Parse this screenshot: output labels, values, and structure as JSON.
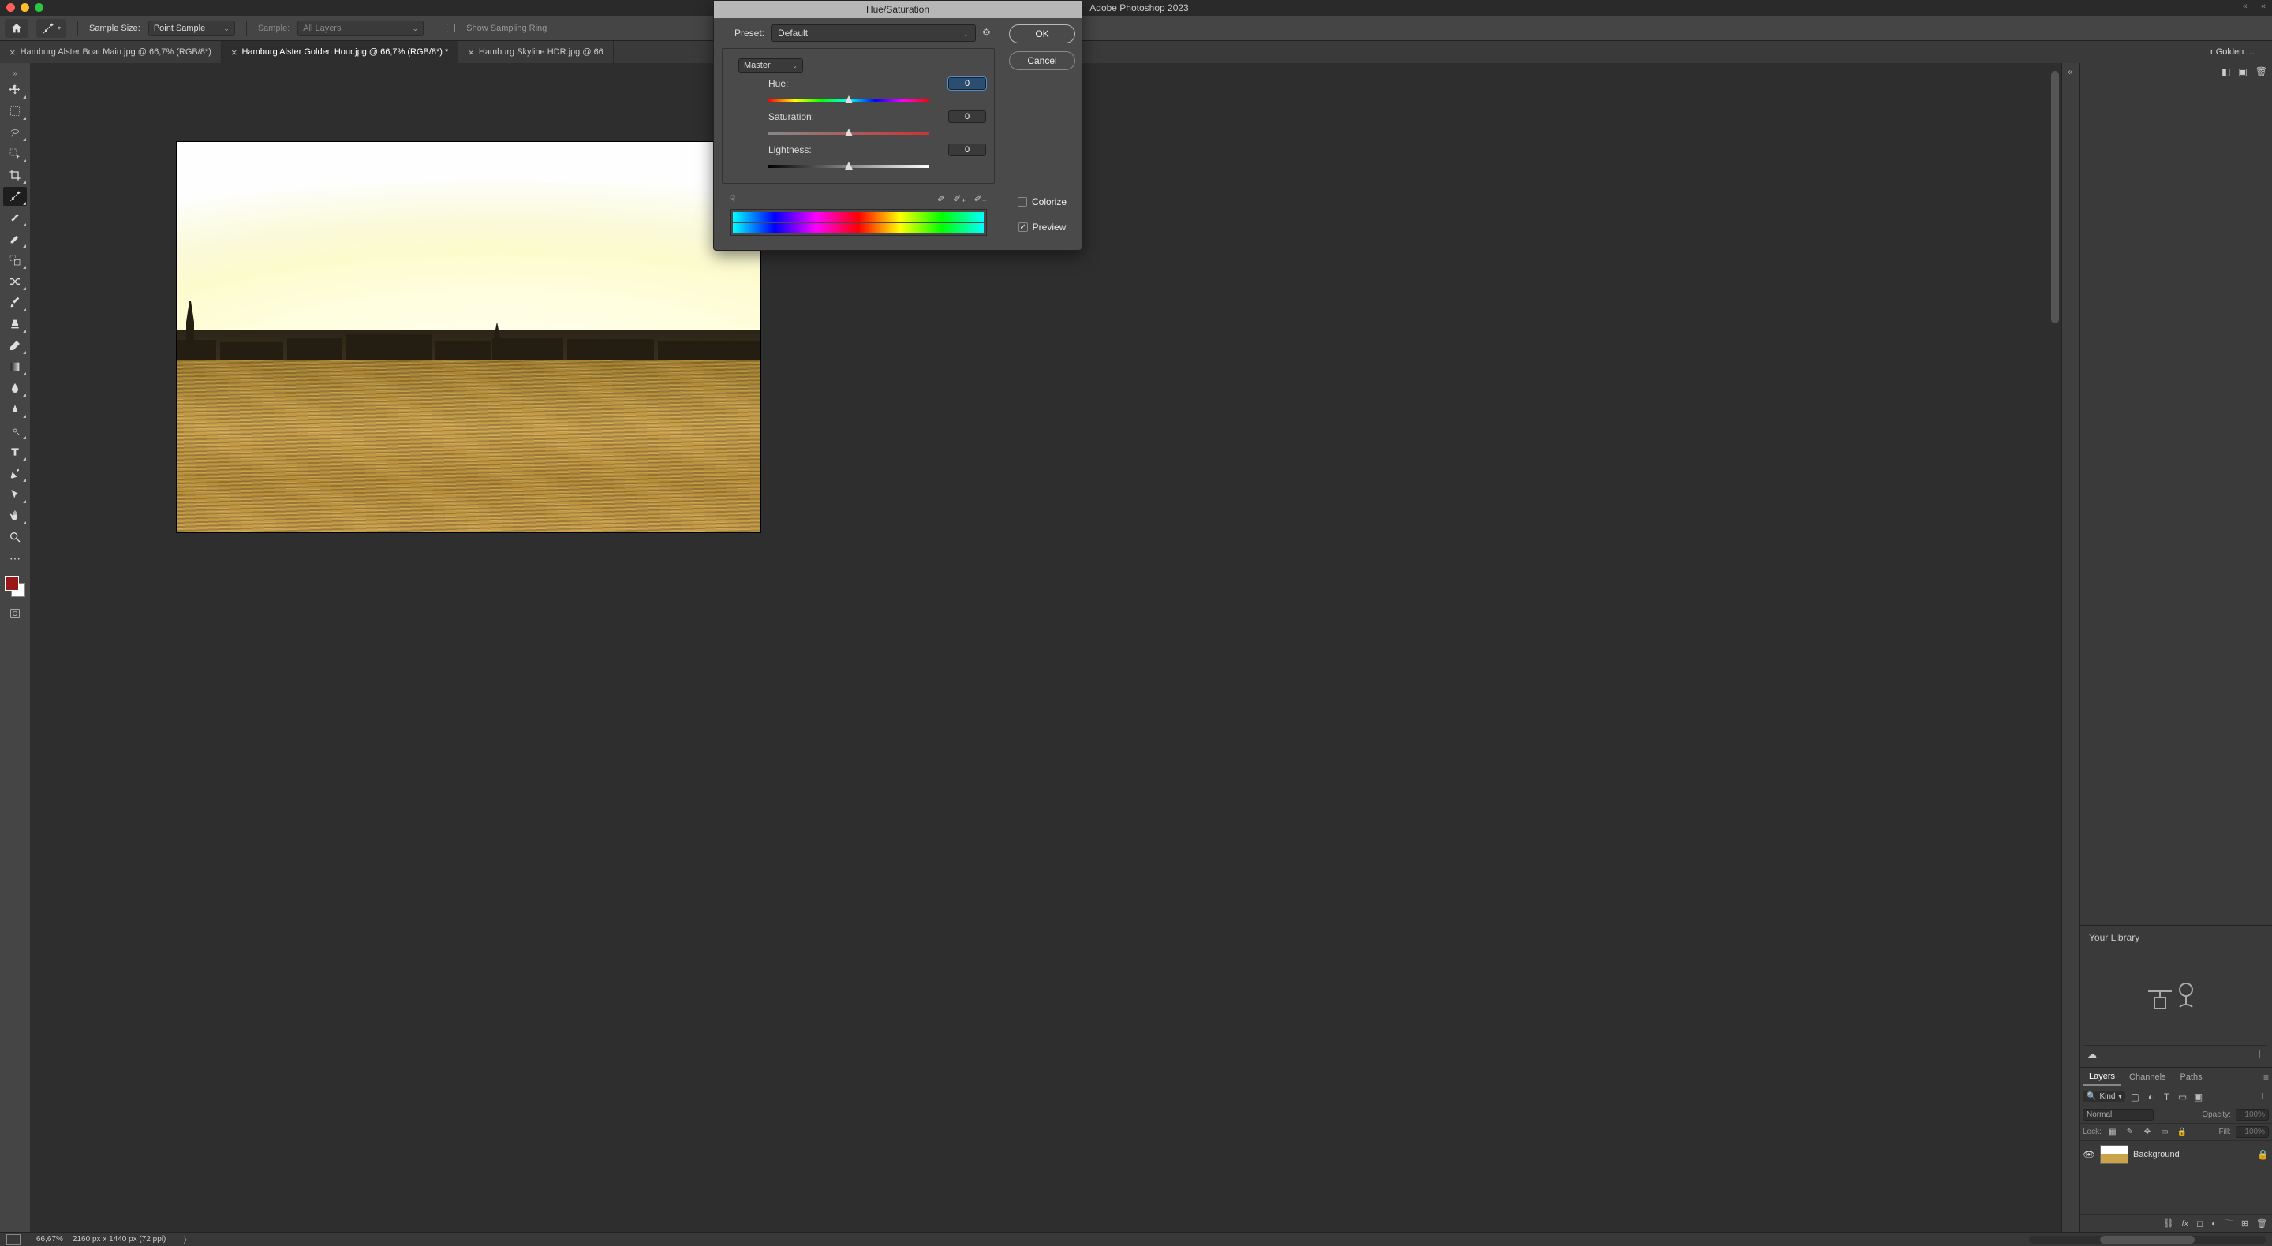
{
  "app_title": "Adobe Photoshop 2023",
  "options_bar": {
    "sample_size_label": "Sample Size:",
    "sample_size_value": "Point Sample",
    "sample_label": "Sample:",
    "sample_value": "All Layers",
    "show_sampling_ring": "Show Sampling Ring"
  },
  "tabs": [
    {
      "label": "Hamburg Alster Boat Main.jpg @ 66,7% (RGB/8*)",
      "active": false
    },
    {
      "label": "Hamburg Alster Golden Hour.jpg @ 66,7% (RGB/8*) *",
      "active": true
    },
    {
      "label": "Hamburg Skyline HDR.jpg @ 66",
      "active": false
    }
  ],
  "status": {
    "zoom": "66,67%",
    "doc_info": "2160 px x 1440 px (72 ppi)"
  },
  "toolbox": [
    "move-tool",
    "rect-marquee-tool",
    "lasso-tool",
    "object-select-tool",
    "crop-tool",
    "eyedropper-tool",
    "spot-heal-tool",
    "brush-tool",
    "clone-stamp-tool",
    "history-brush-tool",
    "eraser-tool",
    "gradient-tool",
    "blur-tool",
    "dodge-tool",
    "pen-tool",
    "type-tool",
    "path-select-tool",
    "rectangle-tool",
    "hand-tool",
    "zoom-tool"
  ],
  "floating_label": "r Golden Hour....",
  "libraries": {
    "your_library": "Your Library"
  },
  "layers_panel": {
    "tabs": [
      "Layers",
      "Channels",
      "Paths"
    ],
    "active_tab": "Layers",
    "kind": "Kind",
    "blend_mode": "Normal",
    "opacity_label": "Opacity:",
    "opacity_value": "100%",
    "lock_label": "Lock:",
    "fill_label": "Fill:",
    "fill_value": "100%",
    "layer_name": "Background"
  },
  "hue_sat": {
    "title": "Hue/Saturation",
    "preset_label": "Preset:",
    "preset_value": "Default",
    "ok": "OK",
    "cancel": "Cancel",
    "channel": "Master",
    "hue_label": "Hue:",
    "hue_value": "0",
    "sat_label": "Saturation:",
    "sat_value": "0",
    "light_label": "Lightness:",
    "light_value": "0",
    "colorize": "Colorize",
    "preview": "Preview"
  }
}
